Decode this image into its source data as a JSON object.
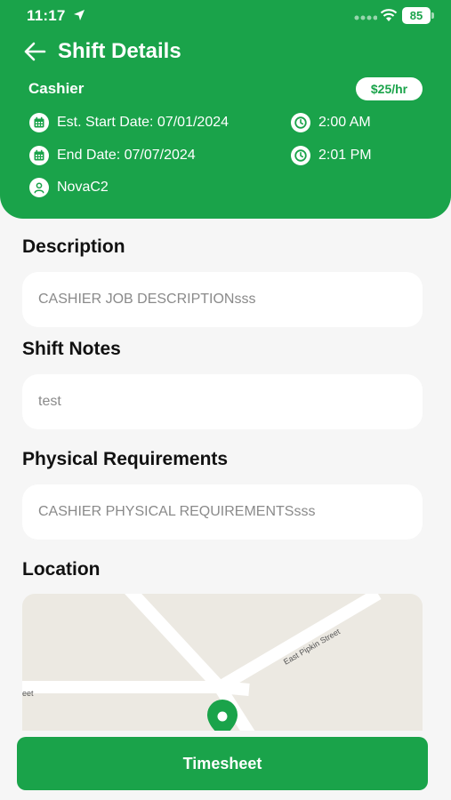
{
  "status_bar": {
    "time": "11:17",
    "battery": "85"
  },
  "header": {
    "title": "Shift Details",
    "role": "Cashier",
    "rate": "$25/hr",
    "start_date": "Est. Start Date: 07/01/2024",
    "start_time": "2:00 AM",
    "end_date": "End Date: 07/07/2024",
    "end_time": "2:01 PM",
    "worker": "NovaC2"
  },
  "sections": {
    "description": {
      "title": "Description",
      "value": "CASHIER JOB DESCRIPTIONsss"
    },
    "shift_notes": {
      "title": "Shift Notes",
      "value": "test"
    },
    "physical": {
      "title": "Physical Requirements",
      "value": "CASHIER PHYSICAL REQUIREMENTSsss"
    },
    "location": {
      "title": "Location"
    }
  },
  "map": {
    "street_label": "East Pipkin Street",
    "partial_label": "eet"
  },
  "actions": {
    "timesheet_label": "Timesheet"
  },
  "colors": {
    "brand": "#1aa34a",
    "background": "#f6f6f6",
    "card": "#ffffff"
  }
}
